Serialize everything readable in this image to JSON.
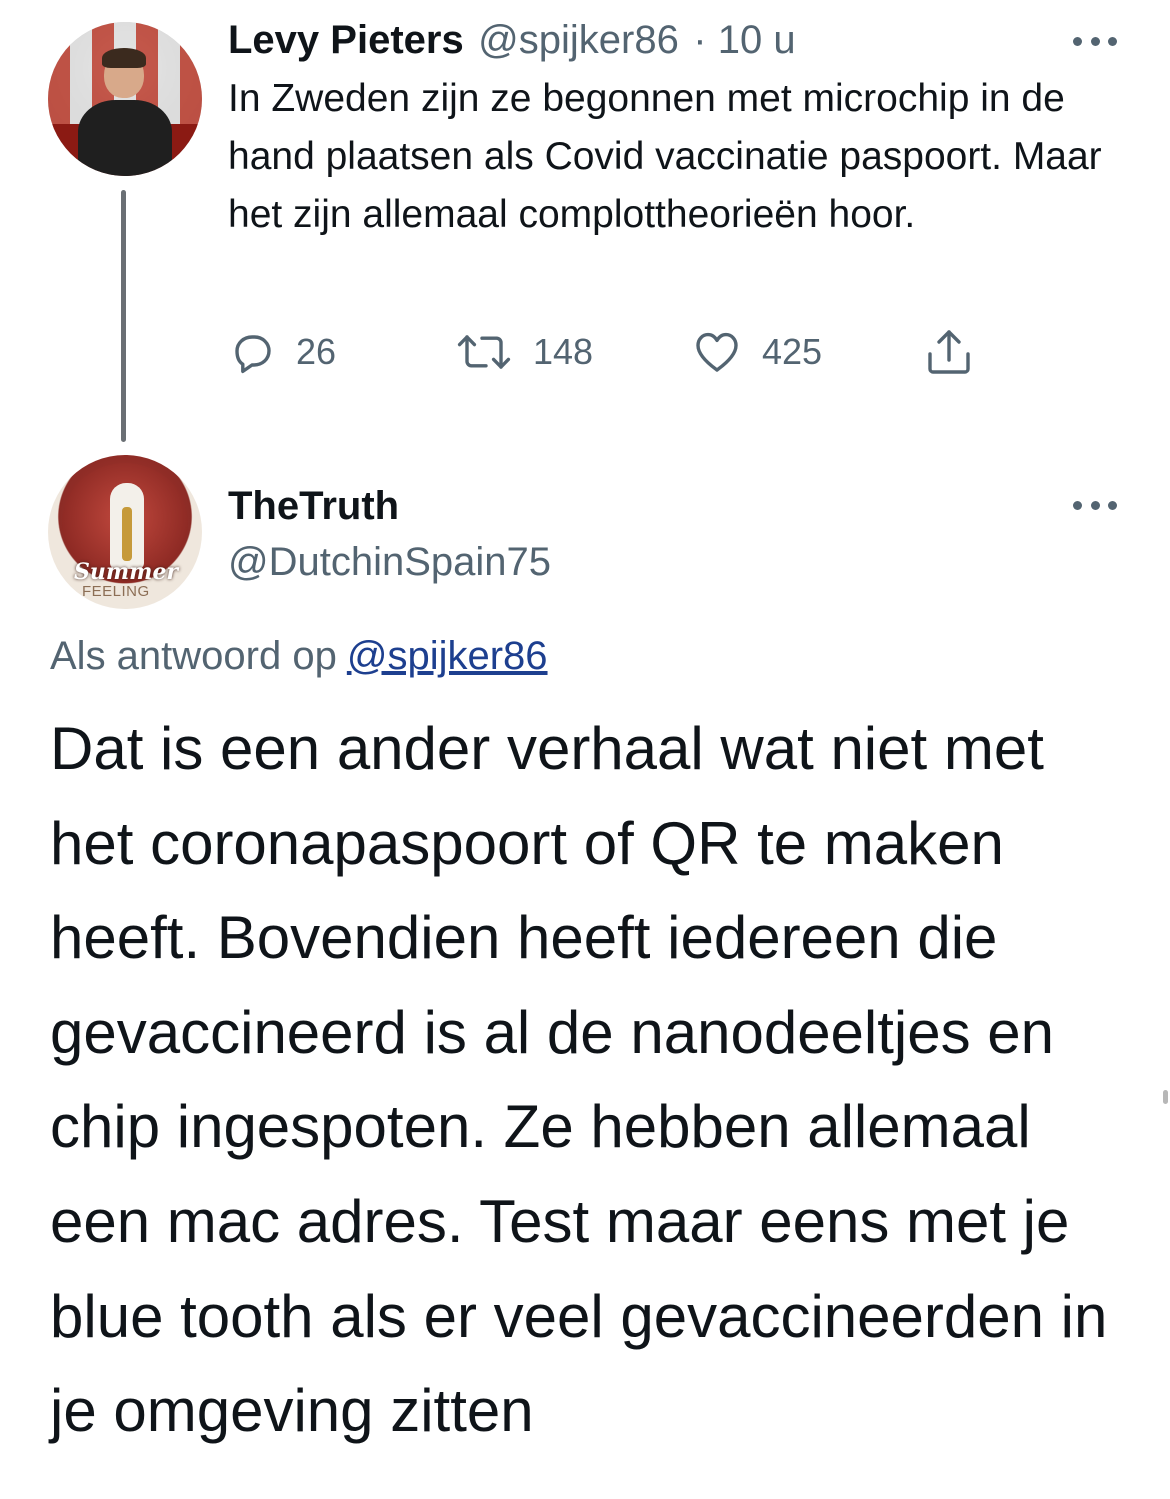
{
  "parent_tweet": {
    "author_name": "Levy Pieters",
    "author_handle": "@spijker86",
    "time": "· 10 u",
    "text": "In Zweden zijn ze begonnen met microchip in de hand plaatsen als Covid vaccinatie paspoort. Maar het zijn allemaal complottheorieën hoor.",
    "actions": {
      "reply_icon": "reply-icon",
      "reply_count": "26",
      "retweet_icon": "retweet-icon",
      "retweet_count": "148",
      "like_icon": "heart-icon",
      "like_count": "425",
      "share_icon": "share-icon"
    }
  },
  "reply_tweet": {
    "author_name": "TheTruth",
    "author_handle": "@DutchinSpain75",
    "avatar_caption_1": "Summer",
    "avatar_caption_2": "FEELING",
    "reply_context_prefix": "Als antwoord op",
    "reply_context_mention": "@spijker86",
    "text": "Dat is een ander verhaal wat niet met het coronapaspoort of QR te maken heeft. Bovendien heeft iedereen die gevaccineerd is al de nanodeeltjes en chip ingespoten. Ze hebben allemaal een mac adres. Test maar eens met je blue tooth als er veel gevaccineerden in je omgeving zitten"
  },
  "colors": {
    "text_primary": "#0f1419",
    "text_secondary": "#536471",
    "mention_link": "#1d3f8f",
    "thread_line": "#6a6f74"
  }
}
